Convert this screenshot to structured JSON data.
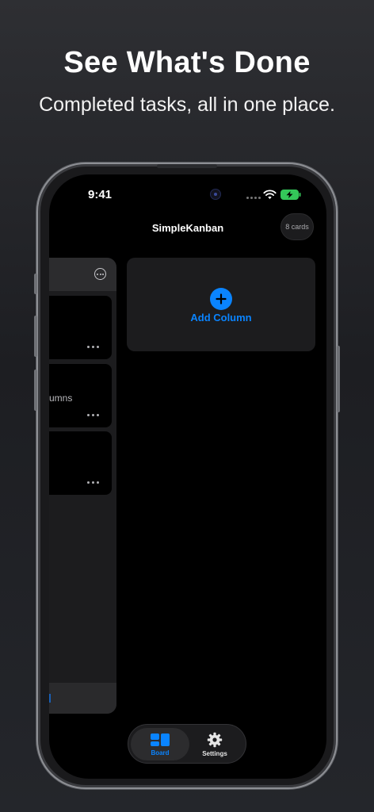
{
  "promo": {
    "headline": "See What's Done",
    "subheadline": "Completed tasks, all in one place."
  },
  "status_bar": {
    "time": "9:41"
  },
  "nav": {
    "title": "SimpleKanban",
    "card_count": "8 cards"
  },
  "column": {
    "cards": [
      {
        "text": ""
      },
      {
        "text": "umns"
      },
      {
        "text": ""
      }
    ]
  },
  "add_column": {
    "label": "Add Column"
  },
  "tabbar": {
    "tabs": [
      {
        "label": "Board",
        "icon": "board-icon",
        "selected": true
      },
      {
        "label": "Settings",
        "icon": "gear-icon",
        "selected": false
      }
    ]
  },
  "colors": {
    "accent": "#0a84ff",
    "battery": "#34c759",
    "background": "#000000",
    "surface": "#1c1c1e"
  }
}
